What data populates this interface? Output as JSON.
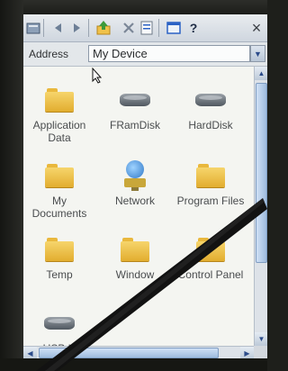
{
  "toolbar": {
    "icons": [
      "folder-up-icon",
      "back-icon",
      "forward-icon",
      "up-folder-icon",
      "delete-icon",
      "properties-icon",
      "view-icon",
      "help-icon",
      "close-icon"
    ],
    "help_glyph": "?",
    "close_glyph": "×"
  },
  "address": {
    "label": "Address",
    "value": "My Device"
  },
  "items": [
    {
      "label": "Application Data",
      "icon": "folder-icon"
    },
    {
      "label": "FRamDisk",
      "icon": "disk-icon"
    },
    {
      "label": "HardDisk",
      "icon": "disk-icon"
    },
    {
      "label": "My Documents",
      "icon": "folder-icon"
    },
    {
      "label": "Network",
      "icon": "network-icon"
    },
    {
      "label": "Program Files",
      "icon": "folder-icon"
    },
    {
      "label": "Temp",
      "icon": "folder-icon"
    },
    {
      "label": "Window",
      "icon": "folder-icon"
    },
    {
      "label": "Control Panel",
      "icon": "folder-icon"
    },
    {
      "label": "USB H",
      "icon": "disk-icon"
    }
  ],
  "colors": {
    "folder": "#f0c24a",
    "accent": "#2b4b8a"
  }
}
